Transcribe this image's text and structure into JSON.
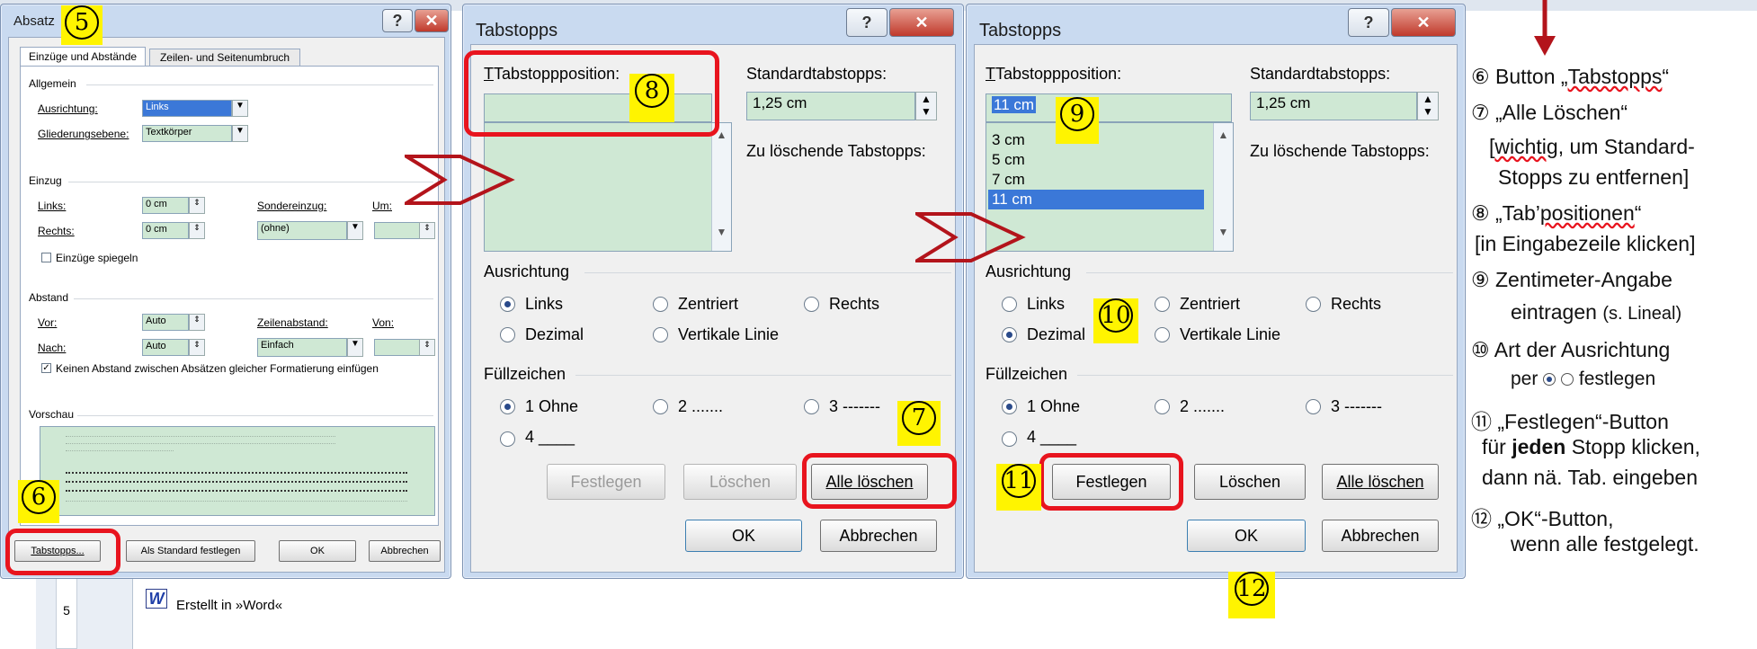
{
  "absatz": {
    "title": "Absatz",
    "tab1": "Einzüge und Abstände",
    "tab2": "Zeilen- und Seitenumbruch",
    "allgemein": "Allgemein",
    "ausrichtung_label": "Ausrichtung:",
    "ausrichtung_value": "Links",
    "gliederung_label": "Gliederungsebene:",
    "gliederung_value": "Textkörper",
    "einzug": "Einzug",
    "links_label": "Links:",
    "links_value": "0 cm",
    "rechts_label": "Rechts:",
    "rechts_value": "0 cm",
    "sondereinzug_label": "Sondereinzug:",
    "sondereinzug_value": "(ohne)",
    "um_label": "Um:",
    "spiegeln": "Einzüge spiegeln",
    "abstand": "Abstand",
    "vor_label": "Vor:",
    "vor_value": "Auto",
    "nach_label": "Nach:",
    "nach_value": "Auto",
    "zeilenabstand_label": "Zeilenabstand:",
    "zeilenabstand_value": "Einfach",
    "von_label": "Von:",
    "keinen_abstand": "Keinen Abstand zwischen Absätzen gleicher Formatierung einfügen",
    "vorschau": "Vorschau",
    "btn_tabstopps": "Tabstopps...",
    "btn_standard": "Als Standard festlegen",
    "btn_ok": "OK",
    "btn_abbrechen": "Abbrechen"
  },
  "tab1": {
    "title": "Tabstopps",
    "position_label": "Tabstoppposition:",
    "position_value": "",
    "list_items": [],
    "standard_label": "Standardtabstopps:",
    "standard_value": "1,25 cm",
    "zu_loeschende": "Zu löschende Tabstopps:",
    "ausrichtung": "Ausrichtung",
    "r_links": "Links",
    "r_zentriert": "Zentriert",
    "r_rechts": "Rechts",
    "r_dezimal": "Dezimal",
    "r_vertikal": "Vertikale Linie",
    "fuellzeichen": "Füllzeichen",
    "f1": "1 Ohne",
    "f2": "2 .......",
    "f3": "3 -------",
    "f4": "4 ____",
    "btn_festlegen": "Festlegen",
    "btn_loeschen": "Löschen",
    "btn_alle": "Alle löschen",
    "btn_ok": "OK",
    "btn_abbrechen": "Abbrechen"
  },
  "tab2": {
    "title": "Tabstopps",
    "position_label": "Tabstoppposition:",
    "position_value": "11 cm",
    "list_items": [
      "3 cm",
      "5 cm",
      "7 cm",
      "11 cm"
    ],
    "standard_label": "Standardtabstopps:",
    "standard_value": "1,25 cm",
    "zu_loeschende": "Zu löschende Tabstopps:",
    "ausrichtung": "Ausrichtung",
    "r_links": "Links",
    "r_zentriert": "Zentriert",
    "r_rechts": "Rechts",
    "r_dezimal": "Dezimal",
    "r_vertikal": "Vertikale Linie",
    "fuellzeichen": "Füllzeichen",
    "f1": "1 Ohne",
    "f2": "2 .......",
    "f3": "3 -------",
    "f4": "4 ____",
    "btn_festlegen": "Festlegen",
    "btn_loeschen": "Löschen",
    "btn_alle": "Alle löschen",
    "btn_ok": "OK",
    "btn_abbrechen": "Abbrechen"
  },
  "markers": {
    "m5": "5",
    "m6": "6",
    "m7": "7",
    "m8": "8",
    "m9": "9",
    "m10": "10",
    "m11": "11",
    "m12": "12"
  },
  "notes": {
    "n6a": "⑥ Button „",
    "n6b": "Tabstopps",
    "n6c": "“",
    "n7": "⑦ „Alle Löschen“",
    "n7b_a": "[",
    "n7b_b": "wichtig",
    "n7b_c": ", um Standard-",
    "n7c": "Stopps zu entfernen]",
    "n8a": "⑧ „Tab’",
    "n8b": "positionen",
    "n8c": "“",
    "n8d": "[in Eingabezeile klicken]",
    "n9": "⑨ Zentimeter-Angabe",
    "n9b": "eintragen",
    "n9c": "(s. Lineal)",
    "n10": "⑩ Art der Ausrichtung",
    "n10b": "per",
    "n10c": "festlegen",
    "n11": "⑪ „Festlegen“-Button",
    "n11b_a": "für ",
    "n11b_b": "jeden",
    "n11b_c": " Stopp klicken,",
    "n11c": "dann nä. Tab. eingeben",
    "n12": "⑫ „OK“-Button,",
    "n12b": "wenn alle festgelegt."
  },
  "doc": {
    "word_text": "Erstellt in »Word«",
    "ruler_mark": "5"
  },
  "colors": {
    "highlight": "#e8141e",
    "marker": "#fff400",
    "field": "#cfe8d4"
  }
}
